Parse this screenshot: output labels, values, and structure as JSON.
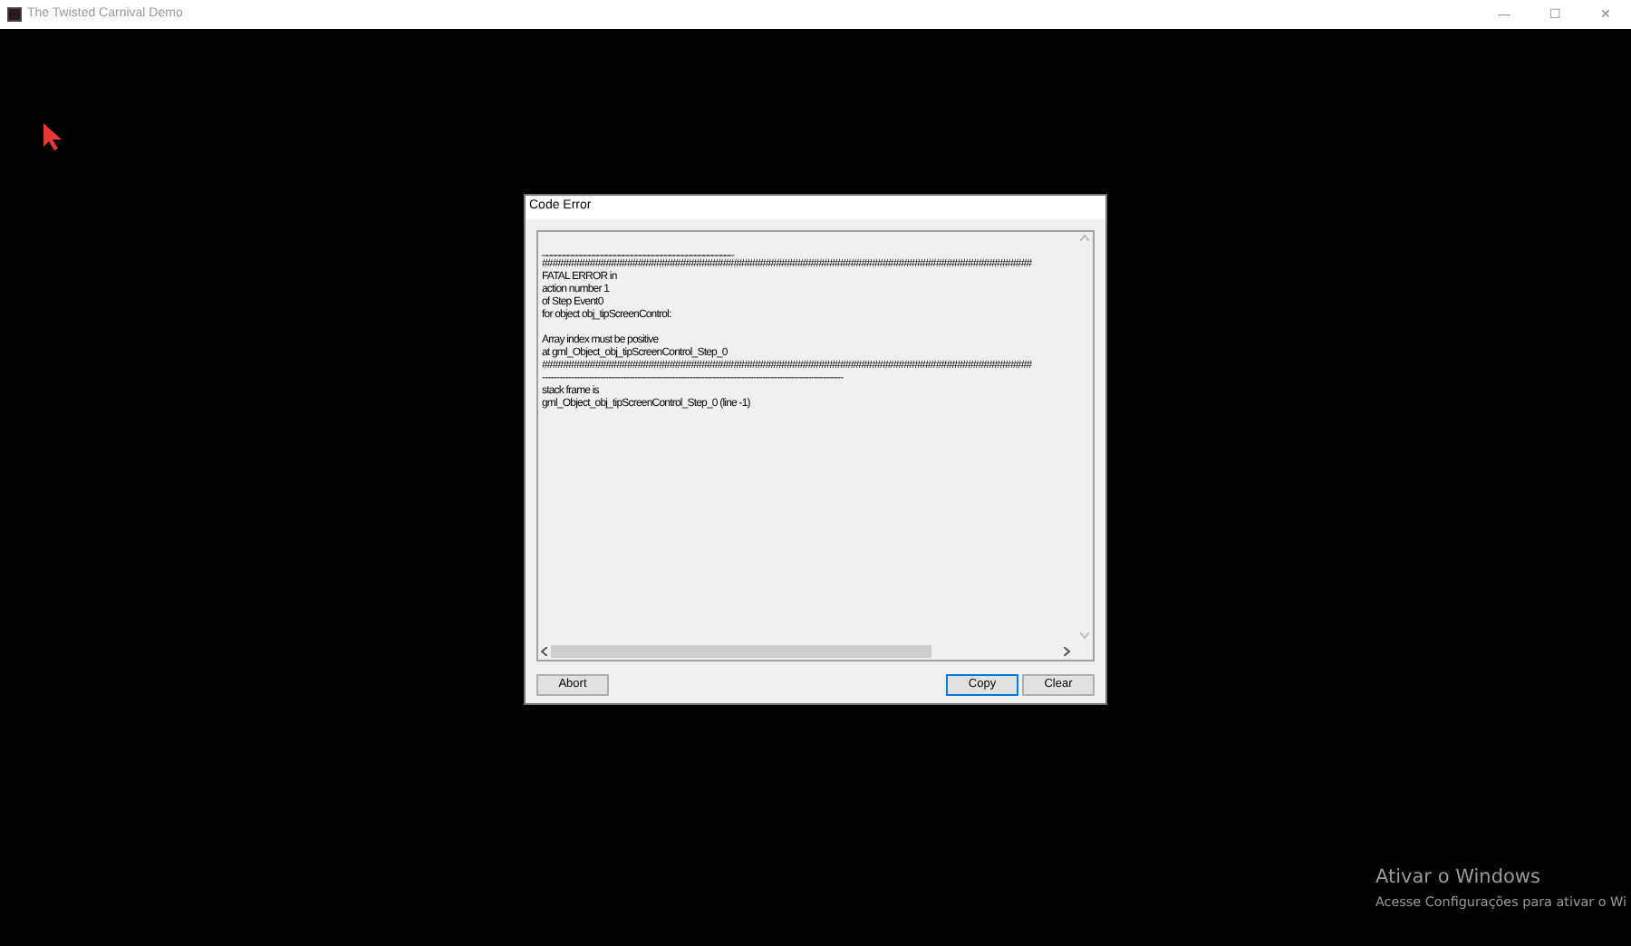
{
  "window": {
    "title": "The Twisted Carnival Demo",
    "controls": [
      "—",
      "☐",
      "✕"
    ]
  },
  "dialog": {
    "title": "Code Error",
    "lines": [
      {
        "kind": "underline",
        "text": "_____________________________________________"
      },
      {
        "kind": "text",
        "text": "############################################################################################"
      },
      {
        "kind": "text",
        "text": "FATAL ERROR in"
      },
      {
        "kind": "text",
        "text": "action number 1"
      },
      {
        "kind": "text",
        "text": "of  Step Event0"
      },
      {
        "kind": "text",
        "text": "for object obj_tipScreenControl:"
      },
      {
        "kind": "blank"
      },
      {
        "kind": "text",
        "text": "Array index must be positive"
      },
      {
        "kind": "text",
        "text": "at gml_Object_obj_tipScreenControl_Step_0"
      },
      {
        "kind": "text",
        "text": "############################################################################################"
      },
      {
        "kind": "text",
        "text": "--------------------------------------------------------------------------------------------------------"
      },
      {
        "kind": "text",
        "text": "stack frame is"
      },
      {
        "kind": "text",
        "text": "gml_Object_obj_tipScreenControl_Step_0 (line -1)"
      }
    ],
    "buttons": [
      {
        "label": "Abort",
        "focused": false
      },
      {
        "label": "Copy",
        "focused": true
      },
      {
        "label": "Clear",
        "focused": false
      }
    ]
  },
  "activation": {
    "title": "Ativar o Windows",
    "text": "Acesse Configurações para ativar o Wi"
  }
}
